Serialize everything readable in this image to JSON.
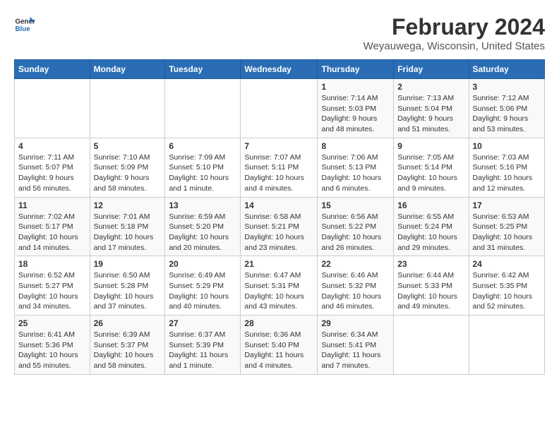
{
  "header": {
    "logo_line1": "General",
    "logo_line2": "Blue",
    "title": "February 2024",
    "subtitle": "Weyauwega, Wisconsin, United States"
  },
  "days_of_week": [
    "Sunday",
    "Monday",
    "Tuesday",
    "Wednesday",
    "Thursday",
    "Friday",
    "Saturday"
  ],
  "weeks": [
    [
      {
        "day": "",
        "detail": ""
      },
      {
        "day": "",
        "detail": ""
      },
      {
        "day": "",
        "detail": ""
      },
      {
        "day": "",
        "detail": ""
      },
      {
        "day": "1",
        "detail": "Sunrise: 7:14 AM\nSunset: 5:03 PM\nDaylight: 9 hours and 48 minutes."
      },
      {
        "day": "2",
        "detail": "Sunrise: 7:13 AM\nSunset: 5:04 PM\nDaylight: 9 hours and 51 minutes."
      },
      {
        "day": "3",
        "detail": "Sunrise: 7:12 AM\nSunset: 5:06 PM\nDaylight: 9 hours and 53 minutes."
      }
    ],
    [
      {
        "day": "4",
        "detail": "Sunrise: 7:11 AM\nSunset: 5:07 PM\nDaylight: 9 hours and 56 minutes."
      },
      {
        "day": "5",
        "detail": "Sunrise: 7:10 AM\nSunset: 5:09 PM\nDaylight: 9 hours and 58 minutes."
      },
      {
        "day": "6",
        "detail": "Sunrise: 7:09 AM\nSunset: 5:10 PM\nDaylight: 10 hours and 1 minute."
      },
      {
        "day": "7",
        "detail": "Sunrise: 7:07 AM\nSunset: 5:11 PM\nDaylight: 10 hours and 4 minutes."
      },
      {
        "day": "8",
        "detail": "Sunrise: 7:06 AM\nSunset: 5:13 PM\nDaylight: 10 hours and 6 minutes."
      },
      {
        "day": "9",
        "detail": "Sunrise: 7:05 AM\nSunset: 5:14 PM\nDaylight: 10 hours and 9 minutes."
      },
      {
        "day": "10",
        "detail": "Sunrise: 7:03 AM\nSunset: 5:16 PM\nDaylight: 10 hours and 12 minutes."
      }
    ],
    [
      {
        "day": "11",
        "detail": "Sunrise: 7:02 AM\nSunset: 5:17 PM\nDaylight: 10 hours and 14 minutes."
      },
      {
        "day": "12",
        "detail": "Sunrise: 7:01 AM\nSunset: 5:18 PM\nDaylight: 10 hours and 17 minutes."
      },
      {
        "day": "13",
        "detail": "Sunrise: 6:59 AM\nSunset: 5:20 PM\nDaylight: 10 hours and 20 minutes."
      },
      {
        "day": "14",
        "detail": "Sunrise: 6:58 AM\nSunset: 5:21 PM\nDaylight: 10 hours and 23 minutes."
      },
      {
        "day": "15",
        "detail": "Sunrise: 6:56 AM\nSunset: 5:22 PM\nDaylight: 10 hours and 26 minutes."
      },
      {
        "day": "16",
        "detail": "Sunrise: 6:55 AM\nSunset: 5:24 PM\nDaylight: 10 hours and 29 minutes."
      },
      {
        "day": "17",
        "detail": "Sunrise: 6:53 AM\nSunset: 5:25 PM\nDaylight: 10 hours and 31 minutes."
      }
    ],
    [
      {
        "day": "18",
        "detail": "Sunrise: 6:52 AM\nSunset: 5:27 PM\nDaylight: 10 hours and 34 minutes."
      },
      {
        "day": "19",
        "detail": "Sunrise: 6:50 AM\nSunset: 5:28 PM\nDaylight: 10 hours and 37 minutes."
      },
      {
        "day": "20",
        "detail": "Sunrise: 6:49 AM\nSunset: 5:29 PM\nDaylight: 10 hours and 40 minutes."
      },
      {
        "day": "21",
        "detail": "Sunrise: 6:47 AM\nSunset: 5:31 PM\nDaylight: 10 hours and 43 minutes."
      },
      {
        "day": "22",
        "detail": "Sunrise: 6:46 AM\nSunset: 5:32 PM\nDaylight: 10 hours and 46 minutes."
      },
      {
        "day": "23",
        "detail": "Sunrise: 6:44 AM\nSunset: 5:33 PM\nDaylight: 10 hours and 49 minutes."
      },
      {
        "day": "24",
        "detail": "Sunrise: 6:42 AM\nSunset: 5:35 PM\nDaylight: 10 hours and 52 minutes."
      }
    ],
    [
      {
        "day": "25",
        "detail": "Sunrise: 6:41 AM\nSunset: 5:36 PM\nDaylight: 10 hours and 55 minutes."
      },
      {
        "day": "26",
        "detail": "Sunrise: 6:39 AM\nSunset: 5:37 PM\nDaylight: 10 hours and 58 minutes."
      },
      {
        "day": "27",
        "detail": "Sunrise: 6:37 AM\nSunset: 5:39 PM\nDaylight: 11 hours and 1 minute."
      },
      {
        "day": "28",
        "detail": "Sunrise: 6:36 AM\nSunset: 5:40 PM\nDaylight: 11 hours and 4 minutes."
      },
      {
        "day": "29",
        "detail": "Sunrise: 6:34 AM\nSunset: 5:41 PM\nDaylight: 11 hours and 7 minutes."
      },
      {
        "day": "",
        "detail": ""
      },
      {
        "day": "",
        "detail": ""
      }
    ]
  ]
}
